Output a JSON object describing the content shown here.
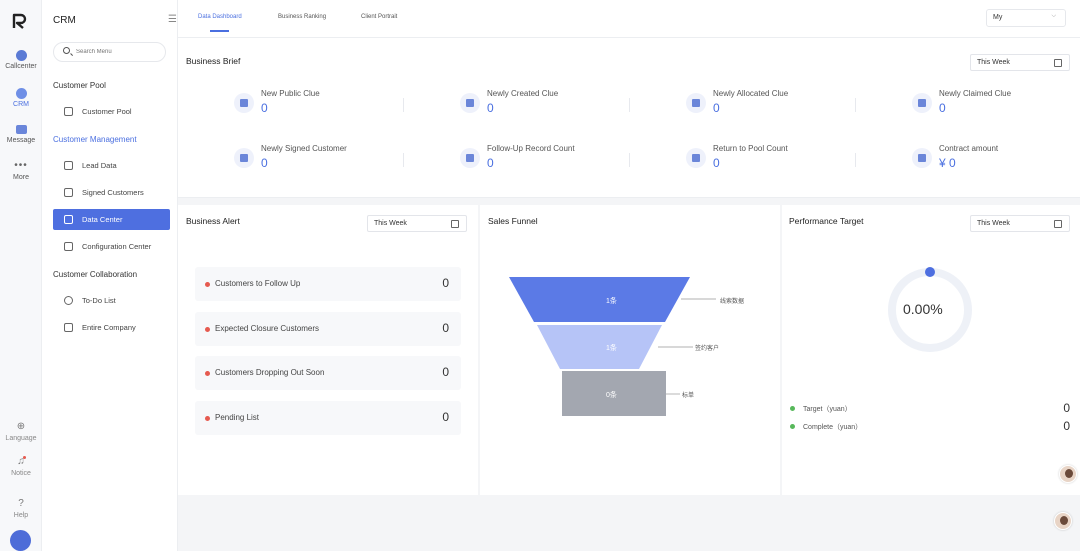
{
  "rail": {
    "items": [
      {
        "label": "Callcenter"
      },
      {
        "label": "CRM"
      },
      {
        "label": "Message"
      },
      {
        "label": "More"
      }
    ],
    "bottom": [
      {
        "label": "Language"
      },
      {
        "label": "Notice"
      },
      {
        "label": "Help"
      }
    ]
  },
  "sidebar": {
    "title": "CRM",
    "search_placeholder": "Search Menu",
    "groups": [
      {
        "label": "Customer Pool",
        "items": [
          {
            "label": "Customer Pool"
          }
        ]
      },
      {
        "label": "Customer Management",
        "items": [
          {
            "label": "Lead Data"
          },
          {
            "label": "Signed Customers"
          },
          {
            "label": "Data Center"
          },
          {
            "label": "Configuration Center"
          }
        ]
      },
      {
        "label": "Customer Collaboration",
        "items": [
          {
            "label": "To-Do List"
          },
          {
            "label": "Entire Company"
          }
        ]
      }
    ]
  },
  "tabs": [
    {
      "label": "Data Dashboard"
    },
    {
      "label": "Business Ranking"
    },
    {
      "label": "Client Portrait"
    }
  ],
  "scope_select": {
    "value": "My"
  },
  "brief": {
    "title": "Business Brief",
    "period": "This Week",
    "metrics": [
      {
        "label": "New Public Clue",
        "value": "0"
      },
      {
        "label": "Newly Created Clue",
        "value": "0"
      },
      {
        "label": "Newly Allocated Clue",
        "value": "0"
      },
      {
        "label": "Newly Claimed Clue",
        "value": "0"
      },
      {
        "label": "Newly Signed Customer",
        "value": "0"
      },
      {
        "label": "Follow-Up Record Count",
        "value": "0"
      },
      {
        "label": "Return to Pool Count",
        "value": "0"
      },
      {
        "label": "Contract amount",
        "value": "¥ 0"
      }
    ]
  },
  "alert": {
    "title": "Business Alert",
    "period": "This Week",
    "rows": [
      {
        "label": "Customers to Follow Up",
        "value": "0"
      },
      {
        "label": "Expected Closure Customers",
        "value": "0"
      },
      {
        "label": "Customers Dropping Out Soon",
        "value": "0"
      },
      {
        "label": "Pending List",
        "value": "0"
      }
    ]
  },
  "funnel": {
    "title": "Sales Funnel",
    "stages": [
      {
        "count": "1条",
        "label": "线索数据",
        "color": "#5b7ae6"
      },
      {
        "count": "1条",
        "label": "签约客户",
        "color": "#b6c4f7"
      },
      {
        "count": "0条",
        "label": "标单",
        "color": "#a3a7b0"
      }
    ]
  },
  "performance": {
    "title": "Performance Target",
    "period": "This Week",
    "percent": "0.00%",
    "progress_fraction": 0,
    "rows": [
      {
        "label": "Target（yuan）",
        "value": "0"
      },
      {
        "label": "Complete（yuan）",
        "value": "0"
      }
    ]
  },
  "colors": {
    "accent": "#4e6fe0",
    "alert_dot": "#e65a4f",
    "legend_dot": "#57b85b"
  }
}
